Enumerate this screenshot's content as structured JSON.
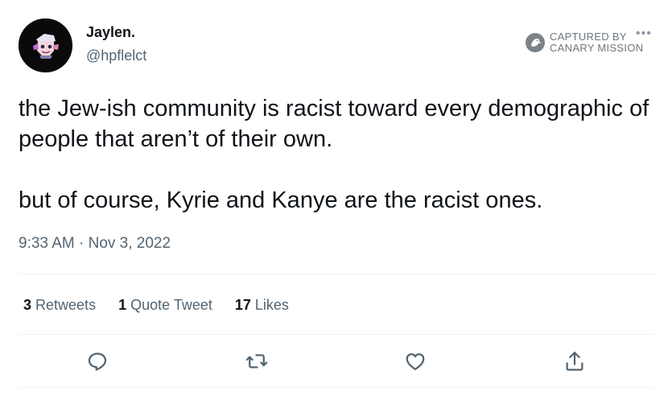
{
  "author": {
    "name": "Jaylen.",
    "handle": "@hpflelct",
    "avatar_icon": "cartoon-avatar-icon"
  },
  "watermark": {
    "line1": "CAPTURED BY",
    "line2": "CANARY MISSION",
    "icon": "canary-mission-logo"
  },
  "more_icon": "more-options-icon",
  "tweet": {
    "paragraph1": "the Jew-ish community is racist toward every demographic of people that aren’t of their own.",
    "paragraph2": "but of course, Kyrie and Kanye are the racist ones.",
    "time": "9:33 AM",
    "separator": "·",
    "date": "Nov 3, 2022"
  },
  "stats": {
    "retweets_count": "3",
    "retweets_label": "Retweets",
    "quotes_count": "1",
    "quotes_label": "Quote Tweet",
    "likes_count": "17",
    "likes_label": "Likes"
  },
  "actions": [
    "reply-icon",
    "retweet-icon",
    "like-icon",
    "share-icon"
  ],
  "colors": {
    "text": "#0f1419",
    "secondary": "#536471",
    "divider": "#eff3f4",
    "background": "#ffffff"
  }
}
